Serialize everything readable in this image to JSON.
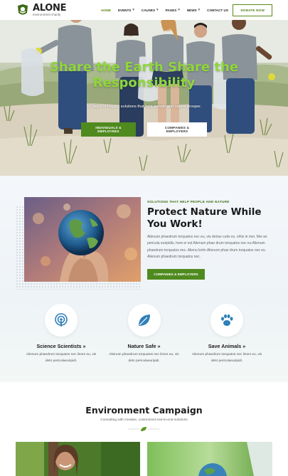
{
  "brand": {
    "name": "ALONE",
    "tagline": "environment charity",
    "accent": "#4f8a1f",
    "title_green": "#8fd63c"
  },
  "nav": {
    "items": [
      {
        "label": "HOME",
        "has_dropdown": false,
        "active": true
      },
      {
        "label": "EVENTS",
        "has_dropdown": true,
        "active": false
      },
      {
        "label": "CAUSES",
        "has_dropdown": true,
        "active": false
      },
      {
        "label": "PAGES",
        "has_dropdown": true,
        "active": false
      },
      {
        "label": "NEWS",
        "has_dropdown": true,
        "active": false
      },
      {
        "label": "CONTACT US",
        "has_dropdown": false,
        "active": false
      }
    ],
    "donate_label": "DONATE NOW"
  },
  "hero": {
    "title": "Share the Earth Share the Responsibility",
    "subtitle": "50 years of forging solutions that help people and nature prosper.",
    "btn_primary": "INDIVIDUALS & EMPLOYEES",
    "btn_secondary": "COMPANIES & EMPLOYERS"
  },
  "about": {
    "eyebrow": "SOLUTIONS THAT HELP PEOPLE AND NATURE",
    "title": "Protect Nature While You Work!",
    "body": "Alienum phaedrum torquatos nec eu, vis detrax cutis ex, nihis in mei. Mei an pericula euripidis, hem ei est Alienum phae drum torquatos nec eu Alienum phaedrum torquatos nec. Alienu lorlm Alienum phae drum torquatos nec eu Alienum phaedrum torquatos nec.",
    "button": "COMPANIES & EMPLOYERS"
  },
  "features": [
    {
      "icon": "podcast-icon",
      "title": "Science Scientists »",
      "desc": "Alienum phaedrum torquatos nec limes eu, vis detn periculaeuripidi."
    },
    {
      "icon": "leaf-icon",
      "title": "Nature Safe »",
      "desc": "Alienum phaedrum torquatos nec limes eu, vis detn periculaeuripidi."
    },
    {
      "icon": "paw-icon",
      "title": "Save Animals »",
      "desc": "Alienum phaedrum torquatos nec limes eu, vis detn periculaeuripidi."
    }
  ],
  "campaign": {
    "title": "Environment Campaign",
    "subtitle": "Consulting with creative, customized end-to-end solutions"
  }
}
